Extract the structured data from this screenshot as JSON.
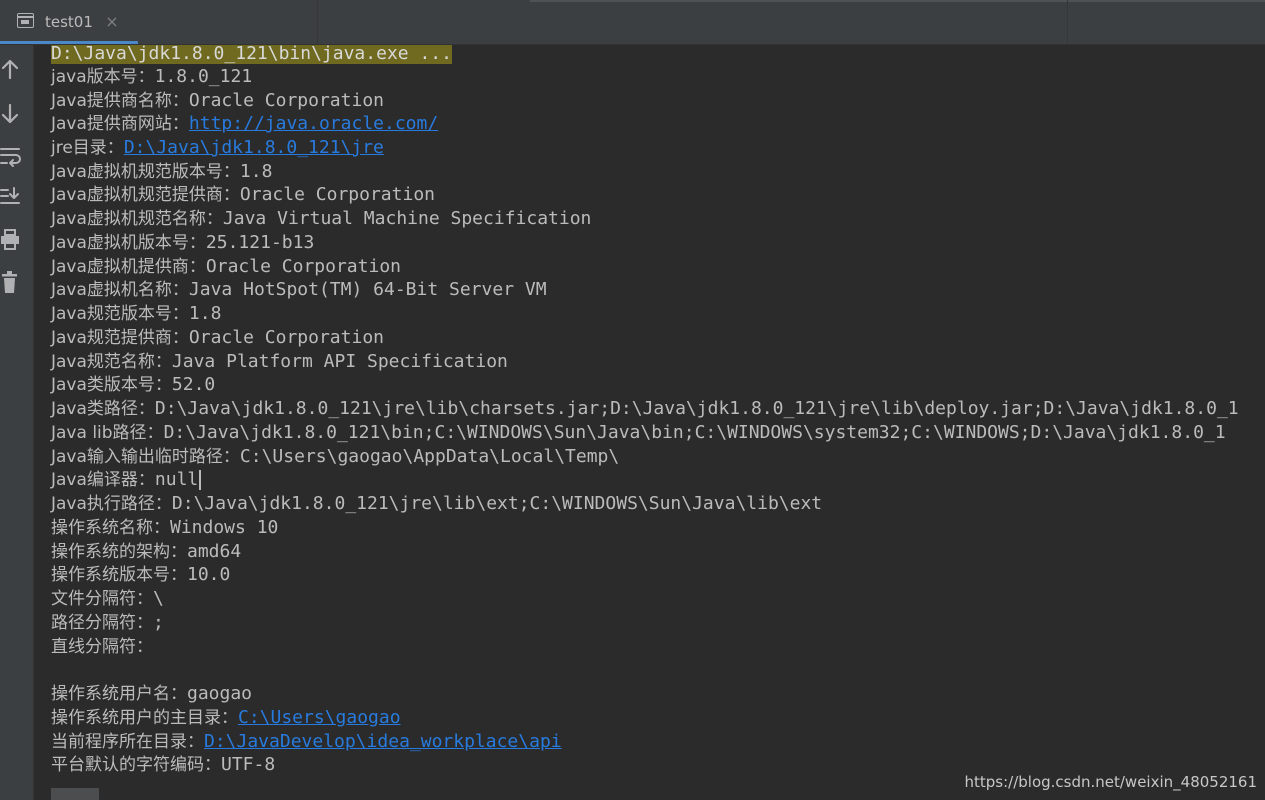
{
  "tab": {
    "label": "test01",
    "close_glyph": "×"
  },
  "toolbar": {
    "buttons": [
      {
        "name": "up-arrow-icon"
      },
      {
        "name": "down-arrow-icon"
      },
      {
        "name": "soft-wrap-icon"
      },
      {
        "name": "scroll-to-end-icon"
      },
      {
        "name": "print-icon"
      },
      {
        "name": "trash-icon"
      }
    ]
  },
  "console": {
    "command": "D:\\Java\\jdk1.8.0_121\\bin\\java.exe ...",
    "l1": {
      "k": "java版本号：",
      "v": "1.8.0_121"
    },
    "l2": {
      "k": "Java提供商名称：",
      "v": "Oracle Corporation"
    },
    "l3": {
      "k": "Java提供商网站：",
      "v": "http://java.oracle.com/"
    },
    "l4": {
      "k": "jre目录：",
      "v": "D:\\Java\\jdk1.8.0_121\\jre"
    },
    "l5": {
      "k": "Java虚拟机规范版本号：",
      "v": "1.8"
    },
    "l6": {
      "k": "Java虚拟机规范提供商：",
      "v": "Oracle Corporation"
    },
    "l7": {
      "k": "Java虚拟机规范名称：",
      "v": "Java Virtual Machine Specification"
    },
    "l8": {
      "k": "Java虚拟机版本号：",
      "v": "25.121-b13"
    },
    "l9": {
      "k": "Java虚拟机提供商：",
      "v": "Oracle Corporation"
    },
    "l10": {
      "k": "Java虚拟机名称：",
      "v": "Java HotSpot(TM) 64-Bit Server VM"
    },
    "l11": {
      "k": "Java规范版本号：",
      "v": "1.8"
    },
    "l12": {
      "k": "Java规范提供商：",
      "v": "Oracle Corporation"
    },
    "l13": {
      "k": "Java规范名称：",
      "v": "Java Platform API Specification"
    },
    "l14": {
      "k": "Java类版本号：",
      "v": "52.0"
    },
    "l15": {
      "k": "Java类路径：",
      "v": "D:\\Java\\jdk1.8.0_121\\jre\\lib\\charsets.jar;D:\\Java\\jdk1.8.0_121\\jre\\lib\\deploy.jar;D:\\Java\\jdk1.8.0_1"
    },
    "l16": {
      "k": "Java lib路径：",
      "v": "D:\\Java\\jdk1.8.0_121\\bin;C:\\WINDOWS\\Sun\\Java\\bin;C:\\WINDOWS\\system32;C:\\WINDOWS;D:\\Java\\jdk1.8.0_1"
    },
    "l17": {
      "k": "Java输入输出临时路径：",
      "v": "C:\\Users\\gaogao\\AppData\\Local\\Temp\\"
    },
    "l18": {
      "k": "Java编译器：",
      "v": "null"
    },
    "l19": {
      "k": "Java执行路径：",
      "v": "D:\\Java\\jdk1.8.0_121\\jre\\lib\\ext;C:\\WINDOWS\\Sun\\Java\\lib\\ext"
    },
    "l20": {
      "k": "操作系统名称：",
      "v": "Windows 10"
    },
    "l21": {
      "k": "操作系统的架构：",
      "v": "amd64"
    },
    "l22": {
      "k": "操作系统版本号：",
      "v": "10.0"
    },
    "l23": {
      "k": "文件分隔符：",
      "v": "\\"
    },
    "l24": {
      "k": "路径分隔符：",
      "v": ";"
    },
    "l25": {
      "k": "直线分隔符：",
      "v": ""
    },
    "l26": {
      "k": "操作系统用户名：",
      "v": "gaogao"
    },
    "l27": {
      "k": "操作系统用户的主目录：",
      "v": "C:\\Users\\gaogao"
    },
    "l28": {
      "k": "当前程序所在目录：",
      "v": "D:\\JavaDevelop\\idea_workplace\\api"
    },
    "l29": {
      "k": "平台默认的字符编码：",
      "v": "UTF-8"
    }
  },
  "watermark": "https://blog.csdn.net/weixin_48052161",
  "colors": {
    "background": "#2b2b2b",
    "panel": "#3c3f41",
    "text": "#bbbbbb",
    "link": "#287bde",
    "highlight": "#6f6a1f",
    "tab_accent": "#4a88c7"
  }
}
